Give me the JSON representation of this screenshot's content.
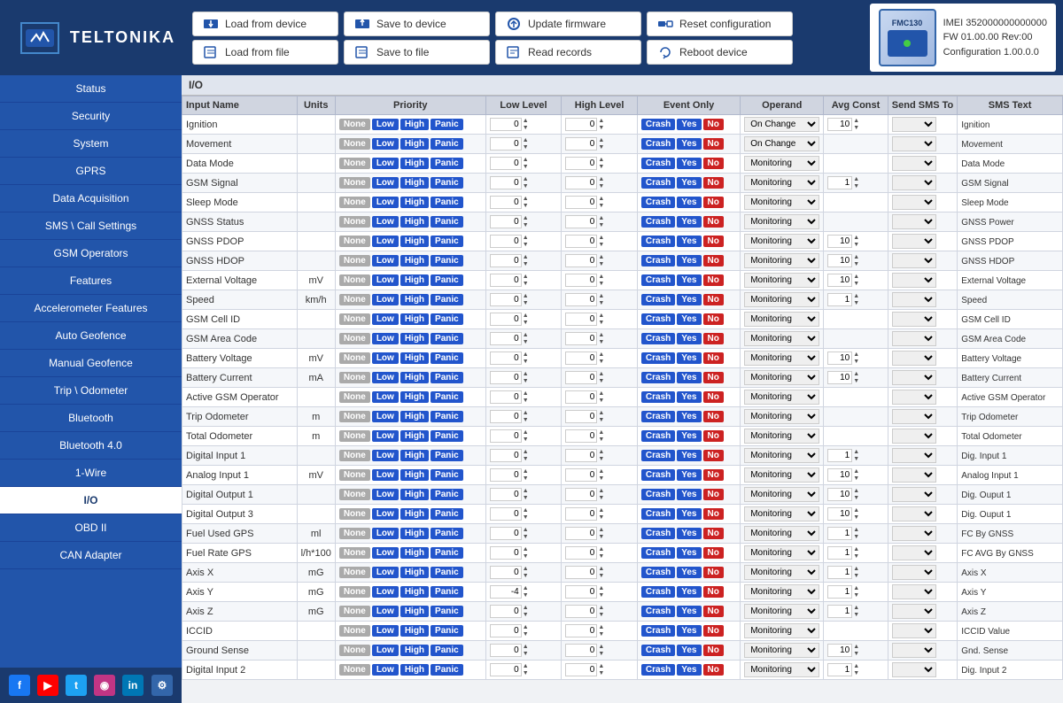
{
  "header": {
    "logo_text": "TELTONIKA",
    "device": {
      "imei": "IMEI 352000000000000",
      "fw": "FW 01.00.00 Rev:00",
      "config": "Configuration 1.00.0.0",
      "model": "FMC130"
    }
  },
  "toolbar": {
    "row1": [
      {
        "label": "Load from device",
        "name": "load-from-device-button"
      },
      {
        "label": "Save to device",
        "name": "save-to-device-button"
      },
      {
        "label": "Update firmware",
        "name": "update-firmware-button"
      },
      {
        "label": "Reset configuration",
        "name": "reset-configuration-button"
      }
    ],
    "row2": [
      {
        "label": "Load from file",
        "name": "load-from-file-button"
      },
      {
        "label": "Save to file",
        "name": "save-to-file-button"
      },
      {
        "label": "Read records",
        "name": "read-records-button"
      },
      {
        "label": "Reboot device",
        "name": "reboot-device-button"
      }
    ]
  },
  "sidebar": {
    "items": [
      {
        "label": "Status",
        "name": "status",
        "active": false
      },
      {
        "label": "Security",
        "name": "security",
        "active": false
      },
      {
        "label": "System",
        "name": "system",
        "active": false
      },
      {
        "label": "GPRS",
        "name": "gprs",
        "active": false
      },
      {
        "label": "Data Acquisition",
        "name": "data-acquisition",
        "active": false
      },
      {
        "label": "SMS \\ Call Settings",
        "name": "sms-call-settings",
        "active": false
      },
      {
        "label": "GSM Operators",
        "name": "gsm-operators",
        "active": false
      },
      {
        "label": "Features",
        "name": "features",
        "active": false
      },
      {
        "label": "Accelerometer Features",
        "name": "accelerometer-features",
        "active": false
      },
      {
        "label": "Auto Geofence",
        "name": "auto-geofence",
        "active": false
      },
      {
        "label": "Manual Geofence",
        "name": "manual-geofence",
        "active": false
      },
      {
        "label": "Trip \\ Odometer",
        "name": "trip-odometer",
        "active": false
      },
      {
        "label": "Bluetooth",
        "name": "bluetooth",
        "active": false
      },
      {
        "label": "Bluetooth 4.0",
        "name": "bluetooth-40",
        "active": false
      },
      {
        "label": "1-Wire",
        "name": "1-wire",
        "active": false
      },
      {
        "label": "I/O",
        "name": "io",
        "active": true
      },
      {
        "label": "OBD II",
        "name": "obd-ii",
        "active": false
      },
      {
        "label": "CAN Adapter",
        "name": "can-adapter",
        "active": false
      }
    ]
  },
  "content": {
    "title": "I/O",
    "table": {
      "columns": [
        "Input Name",
        "Units",
        "Priority",
        "",
        "",
        "",
        "Low Level",
        "",
        "High Level",
        "",
        "Event Only",
        "",
        "",
        "Operand",
        "Avg Const",
        "",
        "Send SMS To",
        "SMS Text"
      ],
      "rows": [
        {
          "name": "Ignition",
          "units": "",
          "low": 0,
          "high": 0,
          "operand": "On Change",
          "avg": 10,
          "sms_text": "Ignition"
        },
        {
          "name": "Movement",
          "units": "",
          "low": 0,
          "high": 0,
          "operand": "On Change",
          "avg": "",
          "sms_text": "Movement"
        },
        {
          "name": "Data Mode",
          "units": "",
          "low": 0,
          "high": 0,
          "operand": "Monitoring",
          "avg": "",
          "sms_text": "Data Mode"
        },
        {
          "name": "GSM Signal",
          "units": "",
          "low": 0,
          "high": 0,
          "operand": "Monitoring",
          "avg": 1,
          "sms_text": "GSM Signal"
        },
        {
          "name": "Sleep Mode",
          "units": "",
          "low": 0,
          "high": 0,
          "operand": "Monitoring",
          "avg": "",
          "sms_text": "Sleep Mode"
        },
        {
          "name": "GNSS Status",
          "units": "",
          "low": 0,
          "high": 0,
          "operand": "Monitoring",
          "avg": "",
          "sms_text": "GNSS Power"
        },
        {
          "name": "GNSS PDOP",
          "units": "",
          "low": 0,
          "high": 0,
          "operand": "Monitoring",
          "avg": 10,
          "sms_text": "GNSS PDOP"
        },
        {
          "name": "GNSS HDOP",
          "units": "",
          "low": 0,
          "high": 0,
          "operand": "Monitoring",
          "avg": 10,
          "sms_text": "GNSS HDOP"
        },
        {
          "name": "External Voltage",
          "units": "mV",
          "low": 0,
          "high": 0,
          "operand": "Monitoring",
          "avg": 10,
          "sms_text": "External Voltage"
        },
        {
          "name": "Speed",
          "units": "km/h",
          "low": 0,
          "high": 0,
          "operand": "Monitoring",
          "avg": 1,
          "sms_text": "Speed"
        },
        {
          "name": "GSM Cell ID",
          "units": "",
          "low": 0,
          "high": 0,
          "operand": "Monitoring",
          "avg": "",
          "sms_text": "GSM Cell ID"
        },
        {
          "name": "GSM Area Code",
          "units": "",
          "low": 0,
          "high": 0,
          "operand": "Monitoring",
          "avg": "",
          "sms_text": "GSM Area Code"
        },
        {
          "name": "Battery Voltage",
          "units": "mV",
          "low": 0,
          "high": 0,
          "operand": "Monitoring",
          "avg": 10,
          "sms_text": "Battery Voltage"
        },
        {
          "name": "Battery Current",
          "units": "mA",
          "low": 0,
          "high": 0,
          "operand": "Monitoring",
          "avg": 10,
          "sms_text": "Battery Current"
        },
        {
          "name": "Active GSM Operator",
          "units": "",
          "low": 0,
          "high": 0,
          "operand": "Monitoring",
          "avg": "",
          "sms_text": "Active GSM Operator"
        },
        {
          "name": "Trip Odometer",
          "units": "m",
          "low": 0,
          "high": 0,
          "operand": "Monitoring",
          "avg": "",
          "sms_text": "Trip Odometer"
        },
        {
          "name": "Total Odometer",
          "units": "m",
          "low": 0,
          "high": 0,
          "operand": "Monitoring",
          "avg": "",
          "sms_text": "Total Odometer"
        },
        {
          "name": "Digital Input 1",
          "units": "",
          "low": 0,
          "high": 0,
          "operand": "Monitoring",
          "avg": 1,
          "sms_text": "Dig. Input 1"
        },
        {
          "name": "Analog Input 1",
          "units": "mV",
          "low": 0,
          "high": 0,
          "operand": "Monitoring",
          "avg": 10,
          "sms_text": "Analog Input 1"
        },
        {
          "name": "Digital Output 1",
          "units": "",
          "low": 0,
          "high": 0,
          "operand": "Monitoring",
          "avg": 10,
          "sms_text": "Dig. Ouput 1"
        },
        {
          "name": "Digital Output 3",
          "units": "",
          "low": 0,
          "high": 0,
          "operand": "Monitoring",
          "avg": 10,
          "sms_text": "Dig. Ouput 1"
        },
        {
          "name": "Fuel Used GPS",
          "units": "ml",
          "low": 0,
          "high": 0,
          "operand": "Monitoring",
          "avg": 1,
          "sms_text": "FC By GNSS"
        },
        {
          "name": "Fuel Rate GPS",
          "units": "l/h*100",
          "low": 0,
          "high": 0,
          "operand": "Monitoring",
          "avg": 1,
          "sms_text": "FC AVG By GNSS"
        },
        {
          "name": "Axis X",
          "units": "mG",
          "low": 0,
          "high": 0,
          "operand": "Monitoring",
          "avg": 1,
          "sms_text": "Axis X"
        },
        {
          "name": "Axis Y",
          "units": "mG",
          "low": -4,
          "high": 0,
          "operand": "Monitoring",
          "avg": 1,
          "sms_text": "Axis Y"
        },
        {
          "name": "Axis Z",
          "units": "mG",
          "low": 0,
          "high": 0,
          "operand": "Monitoring",
          "avg": 1,
          "sms_text": "Axis Z"
        },
        {
          "name": "ICCID",
          "units": "",
          "low": 0,
          "high": 0,
          "operand": "Monitoring",
          "avg": "",
          "sms_text": "ICCID Value"
        },
        {
          "name": "Ground Sense",
          "units": "",
          "low": 0,
          "high": 0,
          "operand": "Monitoring",
          "avg": 10,
          "sms_text": "Gnd. Sense"
        },
        {
          "name": "Digital Input 2",
          "units": "",
          "low": 0,
          "high": 0,
          "operand": "Monitoring",
          "avg": 1,
          "sms_text": "Dig. Input 2"
        }
      ]
    }
  },
  "footer": {
    "icons": [
      "FB",
      "YT",
      "TW",
      "IG",
      "LI"
    ],
    "gear": "⚙"
  }
}
